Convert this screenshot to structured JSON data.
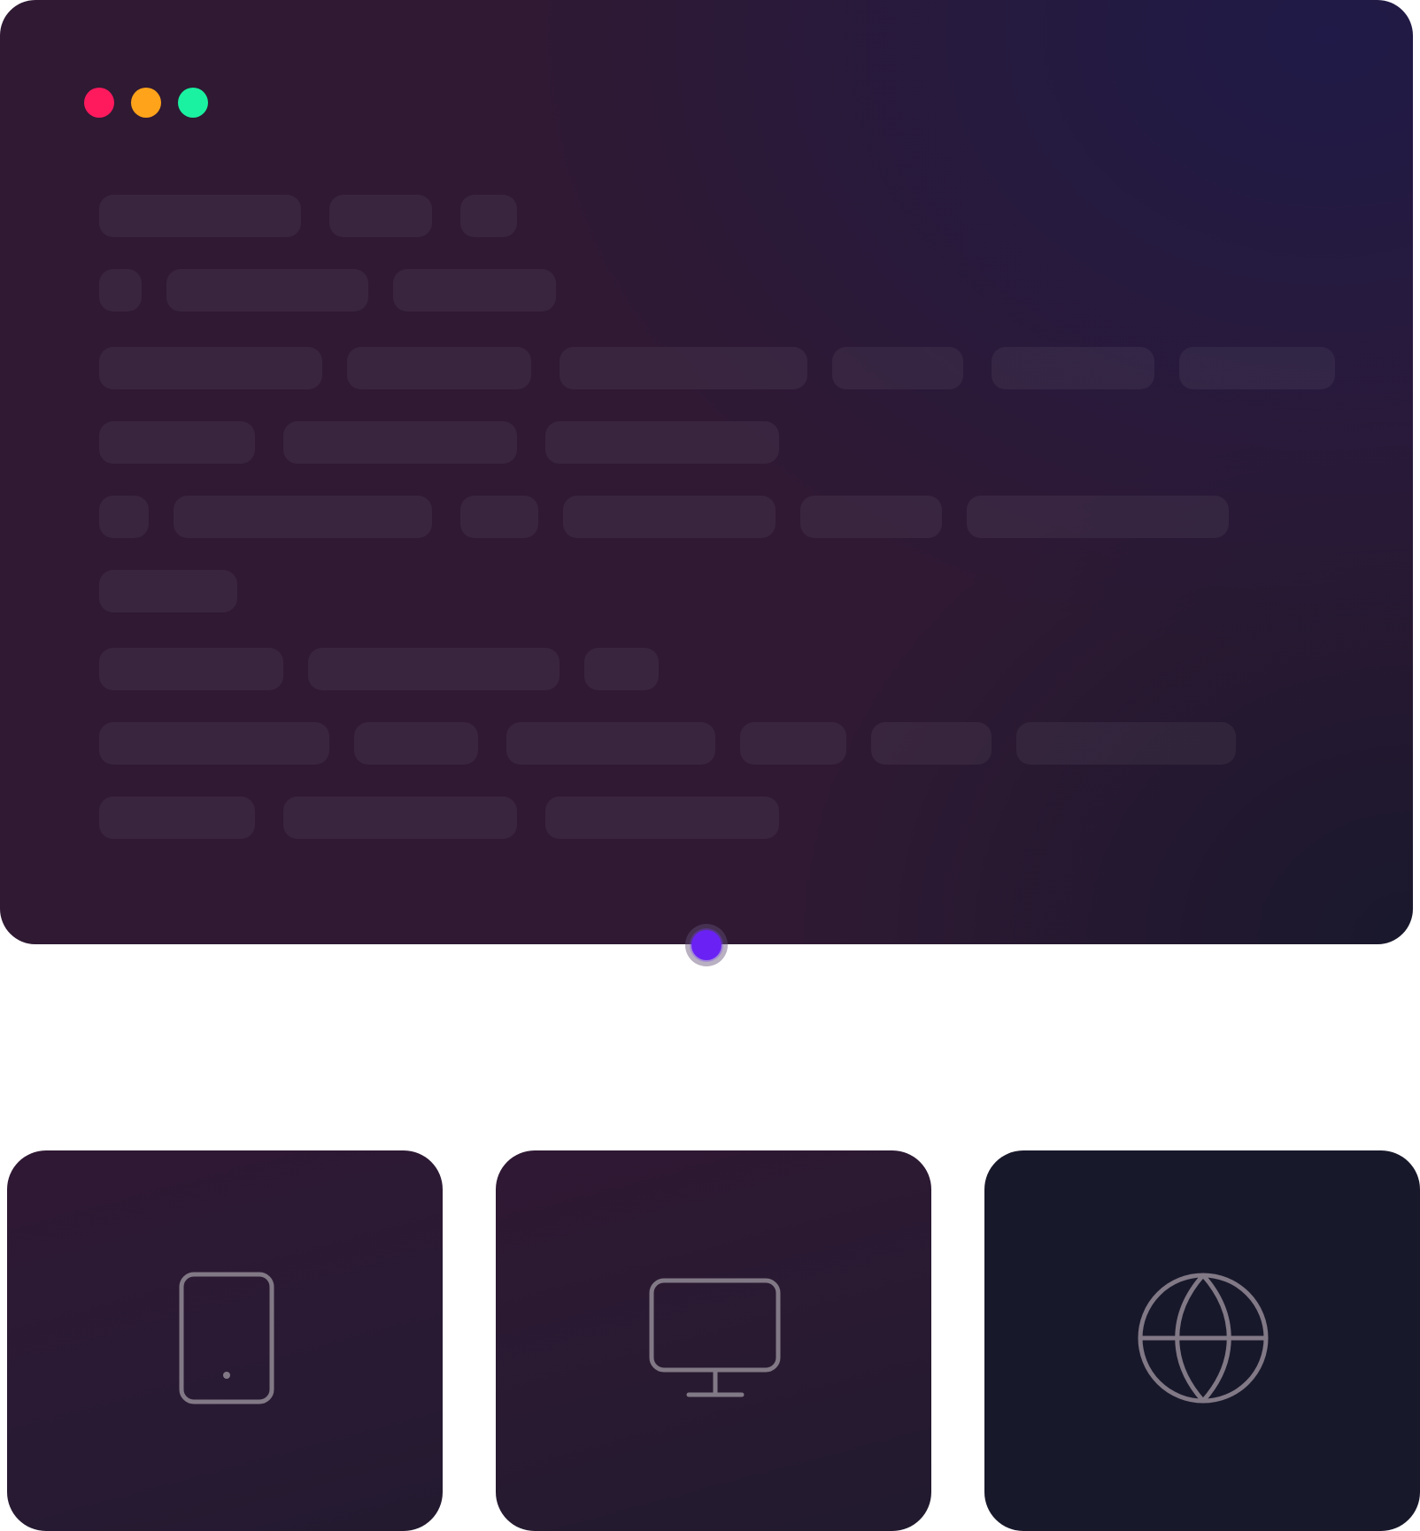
{
  "window": {
    "traffic_lights": [
      {
        "name": "close",
        "color": "#ff1a5e"
      },
      {
        "name": "minimize",
        "color": "#ffa31a"
      },
      {
        "name": "maximize",
        "color": "#1af2a1"
      }
    ]
  },
  "connector": {
    "color": "#6a22f4"
  },
  "cards": [
    {
      "id": "mobile",
      "icon": "mobile-phone-icon"
    },
    {
      "id": "desktop",
      "icon": "desktop-monitor-icon"
    },
    {
      "id": "web",
      "icon": "globe-icon"
    }
  ],
  "colors": {
    "window_background": "#2f1933",
    "window_gradient_accent": "#1e1a48",
    "card_background": "#2f1833",
    "card_web_background": "#18182b",
    "icon_stroke": "#827986"
  }
}
